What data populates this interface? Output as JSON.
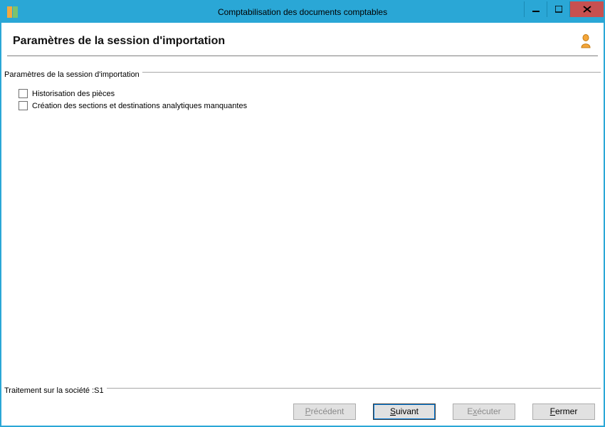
{
  "window": {
    "title": "Comptabilisation des documents comptables"
  },
  "page": {
    "heading": "Paramètres de la session d'importation"
  },
  "params_group": {
    "legend": "Paramètres de la session d'importation",
    "checkbox1": {
      "label": "Historisation des pièces",
      "checked": false
    },
    "checkbox2": {
      "label": "Création des sections et destinations analytiques manquantes",
      "checked": false
    }
  },
  "processing_group": {
    "legend": "Traitement sur la société :S1"
  },
  "buttons": {
    "previous": "Précédent",
    "next": "Suivant",
    "execute": "Exécuter",
    "close": "Fermer"
  }
}
